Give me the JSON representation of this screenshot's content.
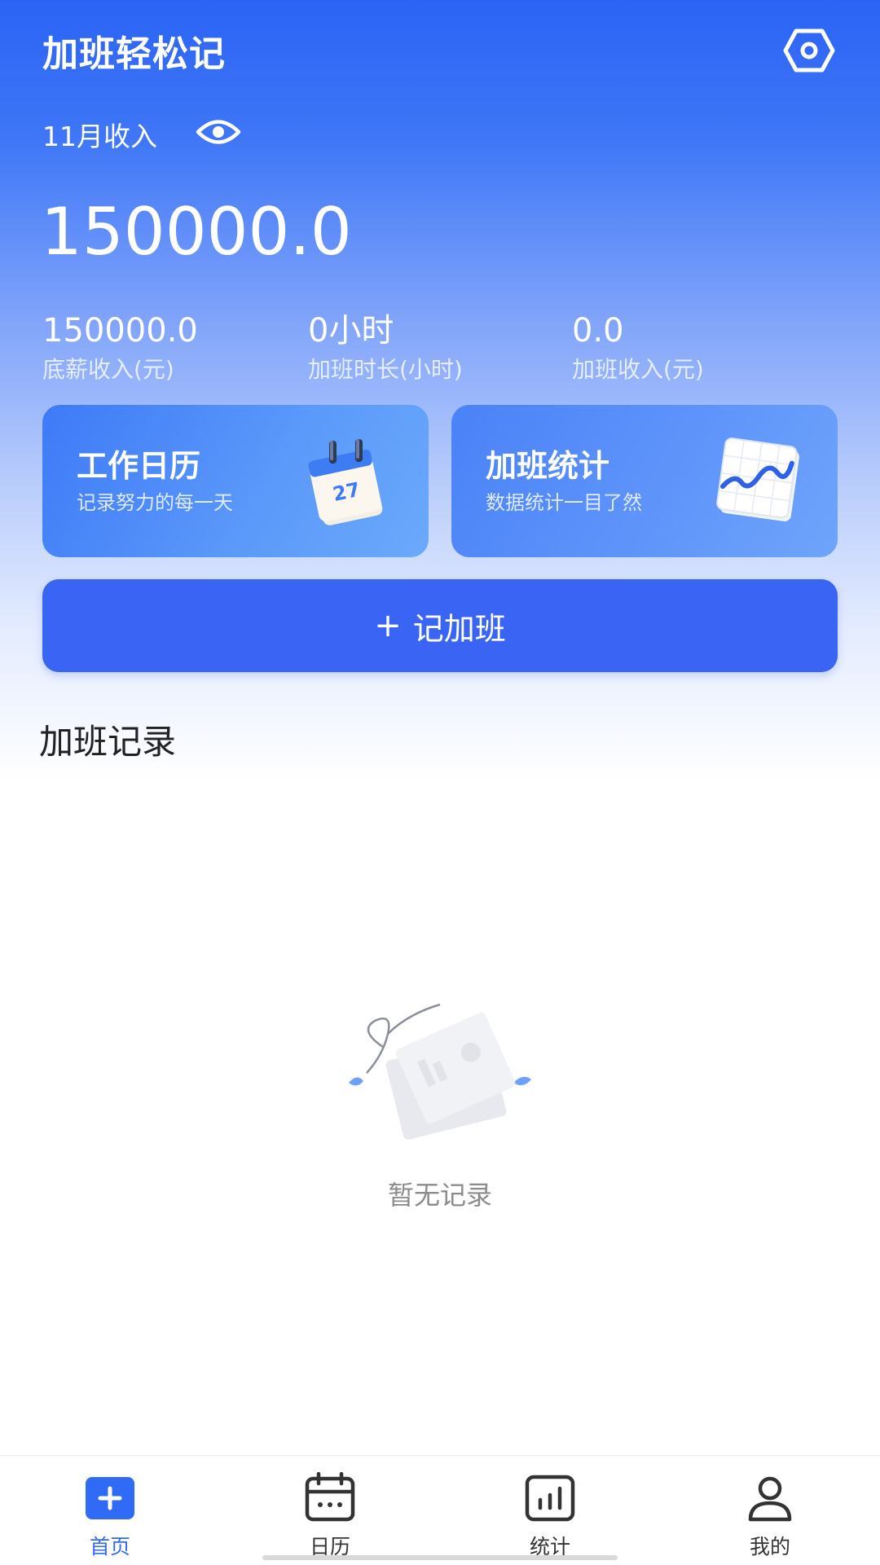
{
  "header": {
    "title": "加班轻松记",
    "settings_icon": "settings-hexagon-icon"
  },
  "summary": {
    "month_label": "11月收入",
    "visibility_icon": "eye-icon",
    "total_income": "150000.0",
    "stats": [
      {
        "value": "150000.0",
        "label": "底薪收入(元)"
      },
      {
        "value": "0小时",
        "label": "加班时长(小时)"
      },
      {
        "value": "0.0",
        "label": "加班收入(元)"
      }
    ]
  },
  "cards": {
    "calendar": {
      "title": "工作日历",
      "subtitle": "记录努力的每一天",
      "icon": "calendar-3d-icon",
      "calendar_day": "27"
    },
    "stats": {
      "title": "加班统计",
      "subtitle": "数据统计一目了然",
      "icon": "chart-3d-icon"
    }
  },
  "actions": {
    "add_overtime_plus": "+",
    "add_overtime_label": "记加班"
  },
  "records": {
    "section_title": "加班记录",
    "empty_text": "暂无记录"
  },
  "tabbar": {
    "items": [
      {
        "label": "首页",
        "icon": "home-plus-icon",
        "active": true
      },
      {
        "label": "日历",
        "icon": "calendar-icon",
        "active": false
      },
      {
        "label": "统计",
        "icon": "bar-chart-icon",
        "active": false
      },
      {
        "label": "我的",
        "icon": "user-icon",
        "active": false
      }
    ]
  },
  "colors": {
    "primary": "#3a64f4",
    "active_tab": "#2f6bf4"
  }
}
